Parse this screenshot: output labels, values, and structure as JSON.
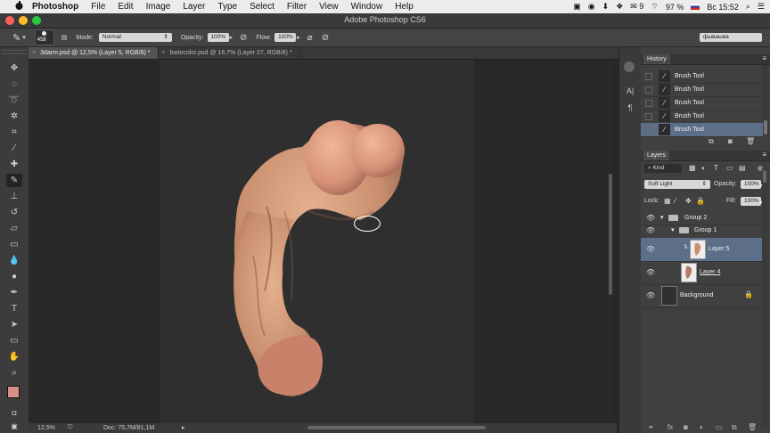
{
  "menubar": {
    "app": "Photoshop",
    "items": [
      "File",
      "Edit",
      "Image",
      "Layer",
      "Type",
      "Select",
      "Filter",
      "View",
      "Window",
      "Help"
    ],
    "status": {
      "battery": "97 %",
      "day_time": "Вс 15:52",
      "icon_count": "9"
    }
  },
  "window": {
    "title": "Adobe Photoshop CS6"
  },
  "options": {
    "brush_size": "458",
    "mode_label": "Mode:",
    "mode_value": "Normal",
    "opacity_label": "Opacity:",
    "opacity_value": "100%",
    "flow_label": "Flow:",
    "flow_value": "100%",
    "workspace": "фываыва"
  },
  "tabs": [
    {
      "label": "3darm.psd @ 12,5% (Layer 5, RGB/8) *",
      "active": true
    },
    {
      "label": "bwtocolor.psd @ 16,7% (Layer 27, RGB/8) *",
      "active": false
    }
  ],
  "status": {
    "zoom": "12,5%",
    "doc": "Doc: 75,7M/81,1M"
  },
  "history": {
    "title": "History",
    "items": [
      "Brush Tool",
      "Brush Tool",
      "Brush Tool",
      "Brush Tool",
      "Brush Tool"
    ]
  },
  "layers": {
    "title": "Layers",
    "kind_label": "Kind",
    "blend_mode": "Soft Light",
    "opacity_label": "Opacity:",
    "opacity_value": "100%",
    "lock_label": "Lock:",
    "fill_label": "Fill:",
    "fill_value": "100%",
    "rows": [
      "Group 2",
      "Group 1",
      "Layer 5",
      "Layer 4",
      "Background"
    ]
  },
  "colors": {
    "foreground": "#d98f86",
    "background": "#ffffff",
    "selection": "#5d6f88"
  }
}
